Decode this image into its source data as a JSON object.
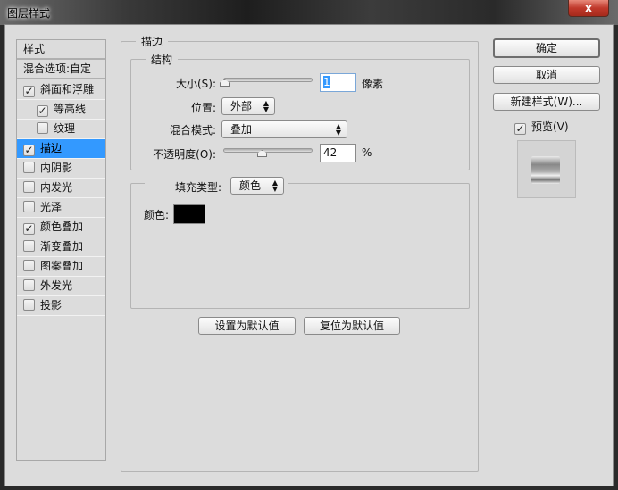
{
  "window": {
    "title": "图层样式",
    "close_label": "x"
  },
  "sidebar": {
    "header": "样式",
    "blend_options": "混合选项:自定",
    "items": [
      {
        "label": "斜面和浮雕",
        "checked": true,
        "indent": false
      },
      {
        "label": "等高线",
        "checked": true,
        "indent": true
      },
      {
        "label": "纹理",
        "checked": false,
        "indent": true
      },
      {
        "label": "描边",
        "checked": true,
        "indent": false,
        "selected": true
      },
      {
        "label": "内阴影",
        "checked": false,
        "indent": false
      },
      {
        "label": "内发光",
        "checked": false,
        "indent": false
      },
      {
        "label": "光泽",
        "checked": false,
        "indent": false
      },
      {
        "label": "颜色叠加",
        "checked": true,
        "indent": false
      },
      {
        "label": "渐变叠加",
        "checked": false,
        "indent": false
      },
      {
        "label": "图案叠加",
        "checked": false,
        "indent": false
      },
      {
        "label": "外发光",
        "checked": false,
        "indent": false
      },
      {
        "label": "投影",
        "checked": false,
        "indent": false
      }
    ]
  },
  "stroke": {
    "title": "描边",
    "structure_title": "结构",
    "size_label": "大小(S):",
    "size_value": "1",
    "size_unit": "像素",
    "size_slider_fraction": 0.0,
    "position_label": "位置:",
    "position_value": "外部",
    "blend_label": "混合模式:",
    "blend_value": "叠加",
    "opacity_label": "不透明度(O):",
    "opacity_value": "42",
    "opacity_unit": "%",
    "opacity_slider_fraction": 0.42,
    "fill_type_label": "填充类型:",
    "fill_type_value": "颜色",
    "color_label": "颜色:",
    "color_value": "#000000",
    "set_default": "设置为默认值",
    "reset_default": "复位为默认值"
  },
  "actions": {
    "ok": "确定",
    "cancel": "取消",
    "new_style": "新建样式(W)...",
    "preview_label": "预览(V)",
    "preview_checked": true
  },
  "colors": {
    "selection": "#3399ff",
    "panel": "#dcdcdc"
  }
}
